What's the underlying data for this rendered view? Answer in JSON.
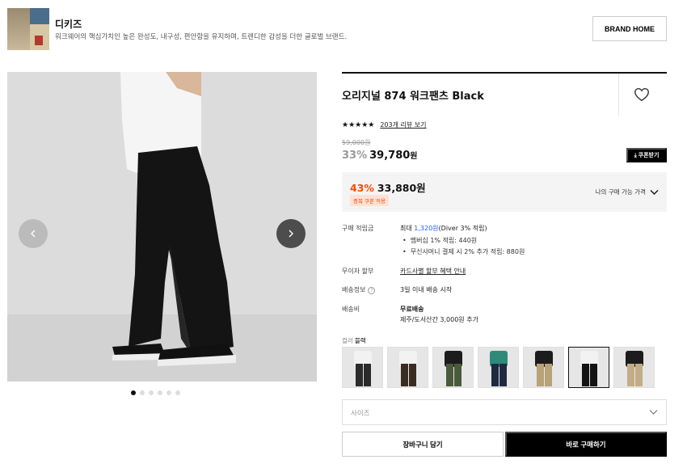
{
  "brand": {
    "name": "디키즈",
    "description": "워크웨어의 핵심가치인 높은 완성도, 내구성, 편안함을 유지하며, 트렌디한 감성을 더한 글로벌 브랜드.",
    "home_button": "BRAND HOME"
  },
  "gallery": {
    "dot_count": 6,
    "active_index": 0
  },
  "product": {
    "title": "오리지널 874 워크팬츠 Black",
    "rating_stars": "★★★★★",
    "review_link": "203개 리뷰 보기",
    "original_price": "59,000원",
    "discount_rate": "33%",
    "sale_price": "39,780",
    "currency": "원",
    "coupon_button": "⤓ 쿠폰받기"
  },
  "best_price": {
    "discount_rate": "43%",
    "amount": "33,880원",
    "badge": "중복 쿠폰 적용",
    "toggle_label": "나의 구매 가능 가격"
  },
  "info": {
    "points_label": "구매 적립금",
    "points_prefix": "최대 ",
    "points_amount": "1,320원",
    "points_suffix": "(Diver 3% 적립)",
    "points_bullet_1": "멤버십 1% 적립: 440원",
    "points_bullet_2": "무신사머니 결제 시 2% 추가 적립: 880원",
    "installment_label": "무이자 할부",
    "installment_link": "카드사별 할부 혜택 안내",
    "shipping_info_label": "배송정보",
    "shipping_info_value": "3일 이내 배송 시작",
    "shipping_fee_label": "배송비",
    "shipping_fee_value": "무료배송",
    "shipping_fee_extra": "제주/도서산간 3,000원 추가"
  },
  "color": {
    "label": "컬러",
    "selected": "블랙",
    "swatches": [
      {
        "top": "#f2f2f2",
        "pants": "#2b2b2b"
      },
      {
        "top": "#f2f2f2",
        "pants": "#3a2c22"
      },
      {
        "top": "#1c1c1c",
        "pants": "#4a5a3c"
      },
      {
        "top": "#2e8b7a",
        "pants": "#1f2a40"
      },
      {
        "top": "#1c1c1c",
        "pants": "#b8a27a"
      },
      {
        "top": "#f2f2f2",
        "pants": "#141414"
      },
      {
        "top": "#1c1c1c",
        "pants": "#c2ad88"
      }
    ],
    "selected_index": 5
  },
  "size_select": {
    "placeholder": "사이즈"
  },
  "actions": {
    "cart_button": "장바구니 담기",
    "buy_button": "바로 구매하기"
  }
}
